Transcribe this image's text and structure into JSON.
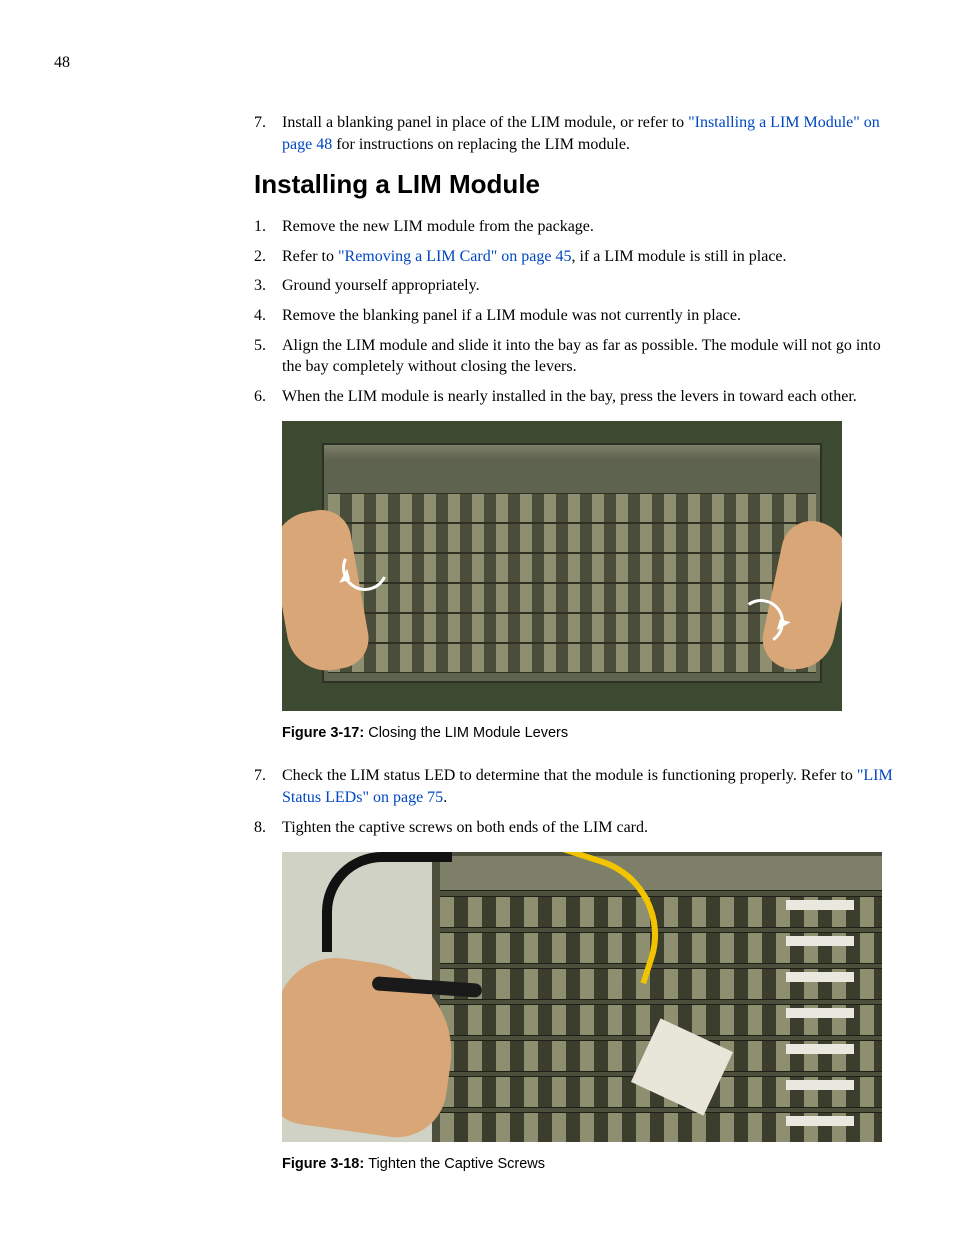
{
  "page_number": "48",
  "intro_step": {
    "num": "7.",
    "pre": "Install a blanking panel in place of the LIM module, or refer to ",
    "link": "\"Installing a LIM Module\" on page 48",
    "post": " for instructions on replacing the LIM module."
  },
  "heading": "Installing a LIM Module",
  "steps_a": [
    {
      "num": "1.",
      "pre": "Remove the new LIM module from the package.",
      "link": "",
      "post": ""
    },
    {
      "num": "2.",
      "pre": "Refer to ",
      "link": "\"Removing a LIM Card\" on page 45",
      "post": ", if a LIM module is still in place."
    },
    {
      "num": "3.",
      "pre": "Ground yourself appropriately.",
      "link": "",
      "post": ""
    },
    {
      "num": "4.",
      "pre": "Remove the blanking panel if a LIM module was not currently in place.",
      "link": "",
      "post": ""
    },
    {
      "num": "5.",
      "pre": "Align the LIM module and slide it into the bay as far as possible. The module will not go into the bay completely without closing the levers.",
      "link": "",
      "post": ""
    },
    {
      "num": "6.",
      "pre": "When the LIM module is nearly installed in the bay, press the levers in toward each other.",
      "link": "",
      "post": ""
    }
  ],
  "figure1": {
    "label": "Figure 3-17: ",
    "caption": "Closing the LIM Module Levers"
  },
  "steps_b": [
    {
      "num": "7.",
      "pre": "Check the LIM status LED to determine that the module is functioning properly. Refer to ",
      "link": "\"LIM Status LEDs\" on page 75",
      "post": "."
    },
    {
      "num": "8.",
      "pre": "Tighten the captive screws on both ends of the LIM card.",
      "link": "",
      "post": ""
    }
  ],
  "figure2": {
    "label": "Figure 3-18: ",
    "caption": "Tighten the Captive Screws"
  }
}
